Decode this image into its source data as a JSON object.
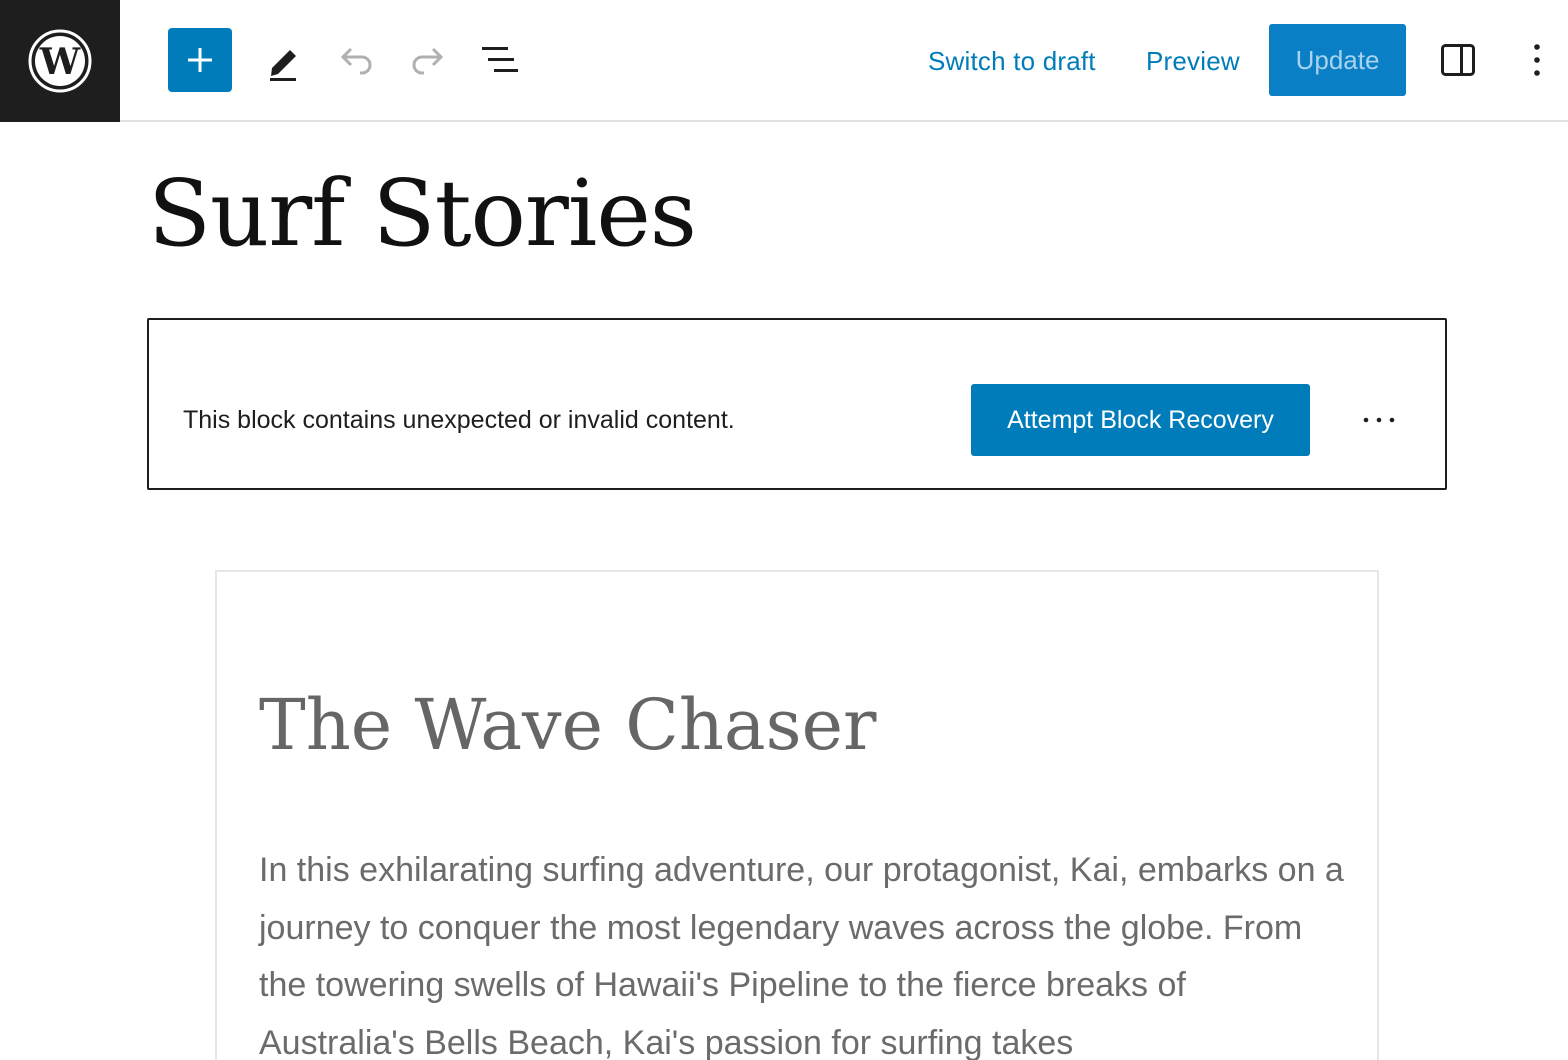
{
  "toolbar": {
    "logo": "wordpress-logo",
    "add_block": "plus-icon",
    "tools": [
      "pencil-icon",
      "undo-icon",
      "redo-icon",
      "list-view-icon"
    ],
    "switch_to_draft": "Switch to draft",
    "preview": "Preview",
    "update": "Update",
    "settings": "sidebar-toggle-icon",
    "options": "more-vertical-icon"
  },
  "post": {
    "title": "Surf Stories"
  },
  "invalid_block": {
    "message": "This block contains unexpected or invalid content.",
    "recover_label": "Attempt Block Recovery",
    "more": "more-horizontal-icon"
  },
  "block_preview": {
    "heading": "The Wave Chaser",
    "paragraph": "In this exhilarating surfing adventure, our protagonist, Kai, embarks on a journey to conquer the most legendary waves across the globe. From the towering swells of Hawaii's Pipeline to the fierce breaks of Australia's Bells Beach, Kai's passion for surfing takes"
  },
  "colors": {
    "accent": "#007cba",
    "dark": "#1e1e1e",
    "muted_text": "#6b6b6b",
    "border": "#e0e0e0"
  }
}
